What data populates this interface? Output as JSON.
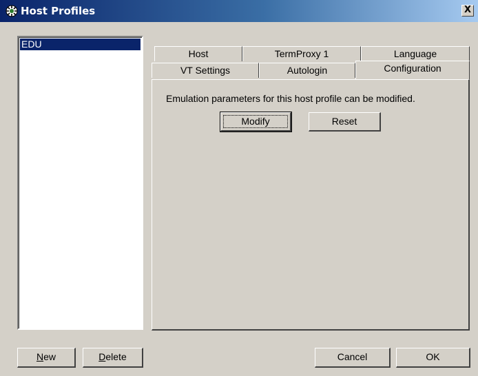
{
  "window": {
    "title": "Host Profiles",
    "close_label": "X"
  },
  "profiles": {
    "items": [
      {
        "label": "EDU",
        "selected": true
      }
    ]
  },
  "tabs": {
    "row1": [
      {
        "label": "Host"
      },
      {
        "label": "TermProxy 1"
      },
      {
        "label": "Language"
      }
    ],
    "row2": [
      {
        "label": "VT Settings"
      },
      {
        "label": "Autologin"
      },
      {
        "label": "Configuration",
        "active": true
      }
    ]
  },
  "configuration": {
    "description": "Emulation parameters for this host profile can be modified.",
    "modify_label": "Modify",
    "reset_label": "Reset"
  },
  "footer": {
    "new_key": "N",
    "new_rest": "ew",
    "delete_key": "D",
    "delete_rest": "elete",
    "cancel_label": "Cancel",
    "ok_label": "OK"
  },
  "colors": {
    "dialog_face": "#d4d0c8",
    "title_active": "#0a246a",
    "selection": "#0a246a"
  },
  "icons": {
    "app": "host-profiles-icon",
    "close": "close-icon"
  }
}
